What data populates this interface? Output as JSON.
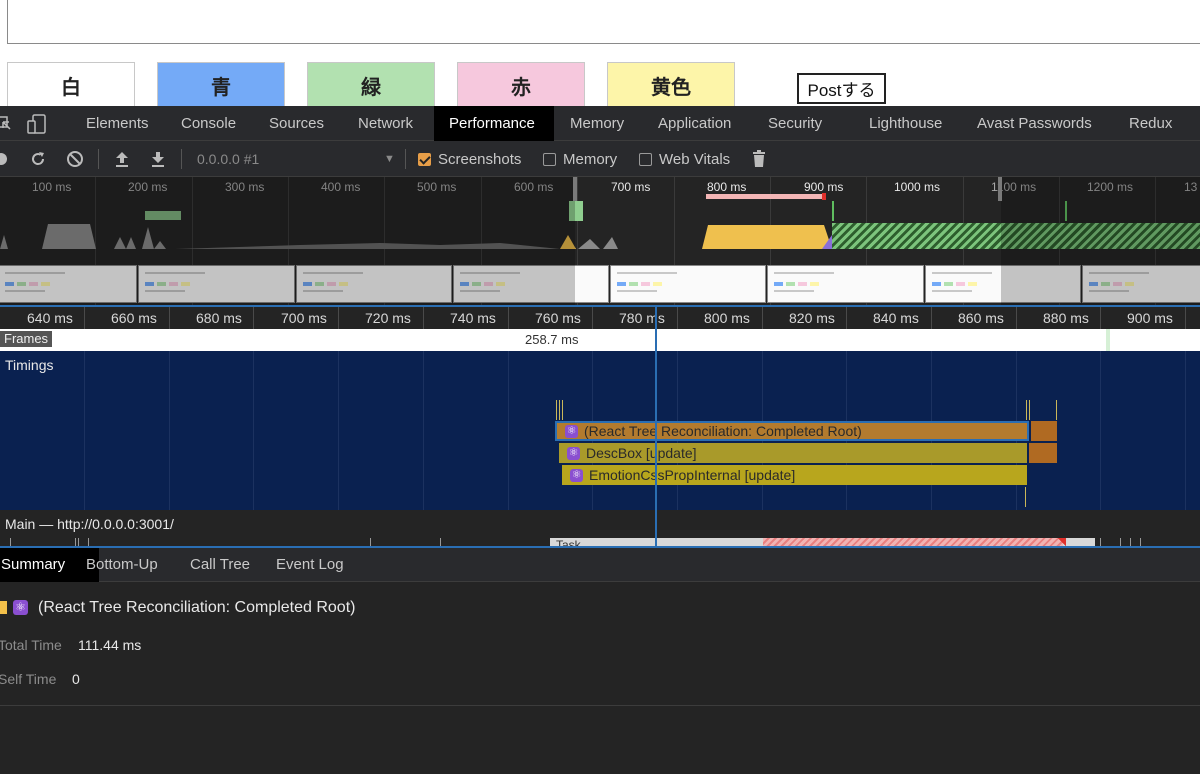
{
  "page": {
    "color_buttons": [
      {
        "label": "白",
        "color": "#ffffff"
      },
      {
        "label": "青",
        "color": "#74aaf7"
      },
      {
        "label": "緑",
        "color": "#b2e1b0"
      },
      {
        "label": "赤",
        "color": "#f6c8dd"
      },
      {
        "label": "黄色",
        "color": "#fdf5a9"
      }
    ],
    "post_label": "Postする"
  },
  "devtools": {
    "tabs": [
      "Elements",
      "Console",
      "Sources",
      "Network",
      "Performance",
      "Memory",
      "Application",
      "Security",
      "Lighthouse",
      "Avast Passwords",
      "Redux"
    ],
    "active_tab": "Performance",
    "toolbar": {
      "profile_select": "0.0.0.0 #1",
      "screenshots_label": "Screenshots",
      "screenshots_checked": true,
      "memory_label": "Memory",
      "memory_checked": false,
      "web_vitals_label": "Web Vitals",
      "web_vitals_checked": false
    }
  },
  "overview": {
    "ticks": [
      "100 ms",
      "200 ms",
      "300 ms",
      "400 ms",
      "500 ms",
      "600 ms",
      "700 ms",
      "800 ms",
      "900 ms",
      "1000 ms",
      "1100 ms",
      "1200 ms",
      "13"
    ]
  },
  "ruler": {
    "ticks": [
      "640 ms",
      "660 ms",
      "680 ms",
      "700 ms",
      "720 ms",
      "740 ms",
      "760 ms",
      "780 ms",
      "800 ms",
      "820 ms",
      "840 ms",
      "860 ms",
      "880 ms",
      "900 ms"
    ]
  },
  "frames": {
    "label": "Frames",
    "value": "258.7 ms"
  },
  "timings": {
    "label": "Timings",
    "bars": [
      {
        "label": "(React Tree Reconciliation: Completed Root)",
        "color": "#b37b2e"
      },
      {
        "label": "DescBox [update]",
        "color": "#a99a2a"
      },
      {
        "label": "EmotionCssPropInternal [update]",
        "color": "#b8a61d"
      }
    ]
  },
  "main": {
    "label": "Main — http://0.0.0.0:3001/",
    "task_label": "Task"
  },
  "bottom": {
    "tabs": [
      "Summary",
      "Bottom-Up",
      "Call Tree",
      "Event Log"
    ],
    "active_tab": "Summary",
    "summary": {
      "title": "(React Tree Reconciliation: Completed Root)",
      "total_time_label": "Total Time",
      "total_time_value": "111.44 ms",
      "self_time_label": "Self Time",
      "self_time_value": "0"
    }
  }
}
